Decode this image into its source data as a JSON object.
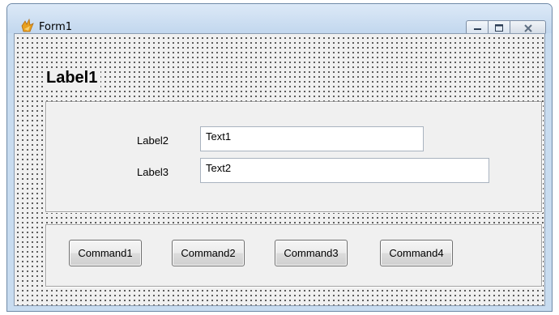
{
  "window": {
    "title": "Form1",
    "controls": {
      "minimize_icon": "minimize-icon",
      "maximize_icon": "maximize-icon",
      "close_icon": "close-icon"
    }
  },
  "form": {
    "heading": "Label1",
    "fields": [
      {
        "label": "Label2",
        "value": "Text1"
      },
      {
        "label": "Label3",
        "value": "Text2"
      }
    ],
    "buttons": [
      {
        "label": "Command1"
      },
      {
        "label": "Command2"
      },
      {
        "label": "Command3"
      },
      {
        "label": "Command4"
      }
    ]
  },
  "colors": {
    "titlebar": "#c8dcf0",
    "form_background": "#f0f0f0",
    "grid_dots": "#000000"
  }
}
